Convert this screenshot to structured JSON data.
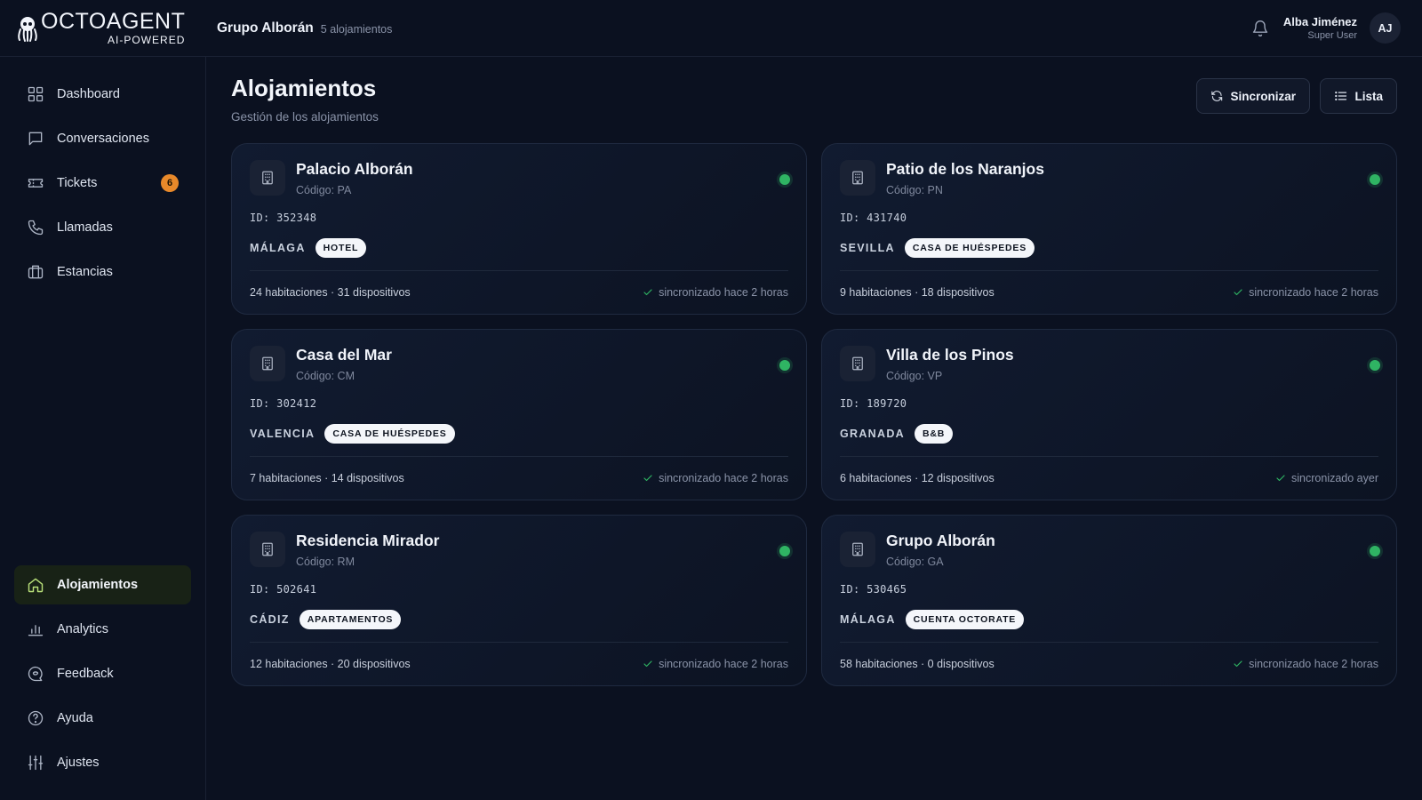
{
  "brand": {
    "name": "OCTOAGENT",
    "tagline": "AI-POWERED"
  },
  "header": {
    "org_name": "Grupo Alborán",
    "org_count": "5 alojamientos",
    "user_name": "Alba Jiménez",
    "user_role": "Super User",
    "avatar_initials": "AJ"
  },
  "sidebar": {
    "items": [
      {
        "label": "Dashboard",
        "icon": "grid-icon"
      },
      {
        "label": "Conversaciones",
        "icon": "chat-icon"
      },
      {
        "label": "Tickets",
        "icon": "ticket-icon",
        "badge": "6"
      },
      {
        "label": "Llamadas",
        "icon": "phone-icon"
      },
      {
        "label": "Estancias",
        "icon": "briefcase-icon"
      },
      {
        "label": "Alojamientos",
        "icon": "home-icon",
        "active": true
      },
      {
        "label": "Analytics",
        "icon": "bar-chart-icon"
      },
      {
        "label": "Feedback",
        "icon": "feedback-icon"
      },
      {
        "label": "Ayuda",
        "icon": "help-icon"
      },
      {
        "label": "Ajustes",
        "icon": "sliders-icon"
      }
    ]
  },
  "main": {
    "title": "Alojamientos",
    "subtitle": "Gestión de los alojamientos",
    "sync_button": "Sincronizar",
    "list_button": "Lista"
  },
  "properties": [
    {
      "name": "Palacio Alborán",
      "code": "Código: PA",
      "id": "ID: 352348",
      "city": "MÁLAGA",
      "type": "HOTEL",
      "stats": "24 habitaciones · 31 dispositivos",
      "sync": "sincronizado hace 2 horas",
      "status": "online"
    },
    {
      "name": "Patio de los Naranjos",
      "code": "Código: PN",
      "id": "ID: 431740",
      "city": "SEVILLA",
      "type": "CASA DE HUÉSPEDES",
      "stats": "9 habitaciones · 18 dispositivos",
      "sync": "sincronizado hace 2 horas",
      "status": "online"
    },
    {
      "name": "Casa del Mar",
      "code": "Código: CM",
      "id": "ID: 302412",
      "city": "VALENCIA",
      "type": "CASA DE HUÉSPEDES",
      "stats": "7 habitaciones · 14 dispositivos",
      "sync": "sincronizado hace 2 horas",
      "status": "online"
    },
    {
      "name": "Villa de los Pinos",
      "code": "Código: VP",
      "id": "ID: 189720",
      "city": "GRANADA",
      "type": "B&B",
      "stats": "6 habitaciones · 12 dispositivos",
      "sync": "sincronizado ayer",
      "status": "online"
    },
    {
      "name": "Residencia Mirador",
      "code": "Código: RM",
      "id": "ID: 502641",
      "city": "CÁDIZ",
      "type": "APARTAMENTOS",
      "stats": "12 habitaciones · 20 dispositivos",
      "sync": "sincronizado hace 2 horas",
      "status": "online"
    },
    {
      "name": "Grupo Alborán",
      "code": "Código: GA",
      "id": "ID: 530465",
      "city": "MÁLAGA",
      "type": "CUENTA OCTORATE",
      "stats": "58 habitaciones · 0 dispositivos",
      "sync": "sincronizado hace 2 horas",
      "status": "online"
    }
  ],
  "colors": {
    "background": "#0b1120",
    "accent_active": "#182216",
    "status_online": "#2fb463",
    "badge": "#e8892a"
  }
}
